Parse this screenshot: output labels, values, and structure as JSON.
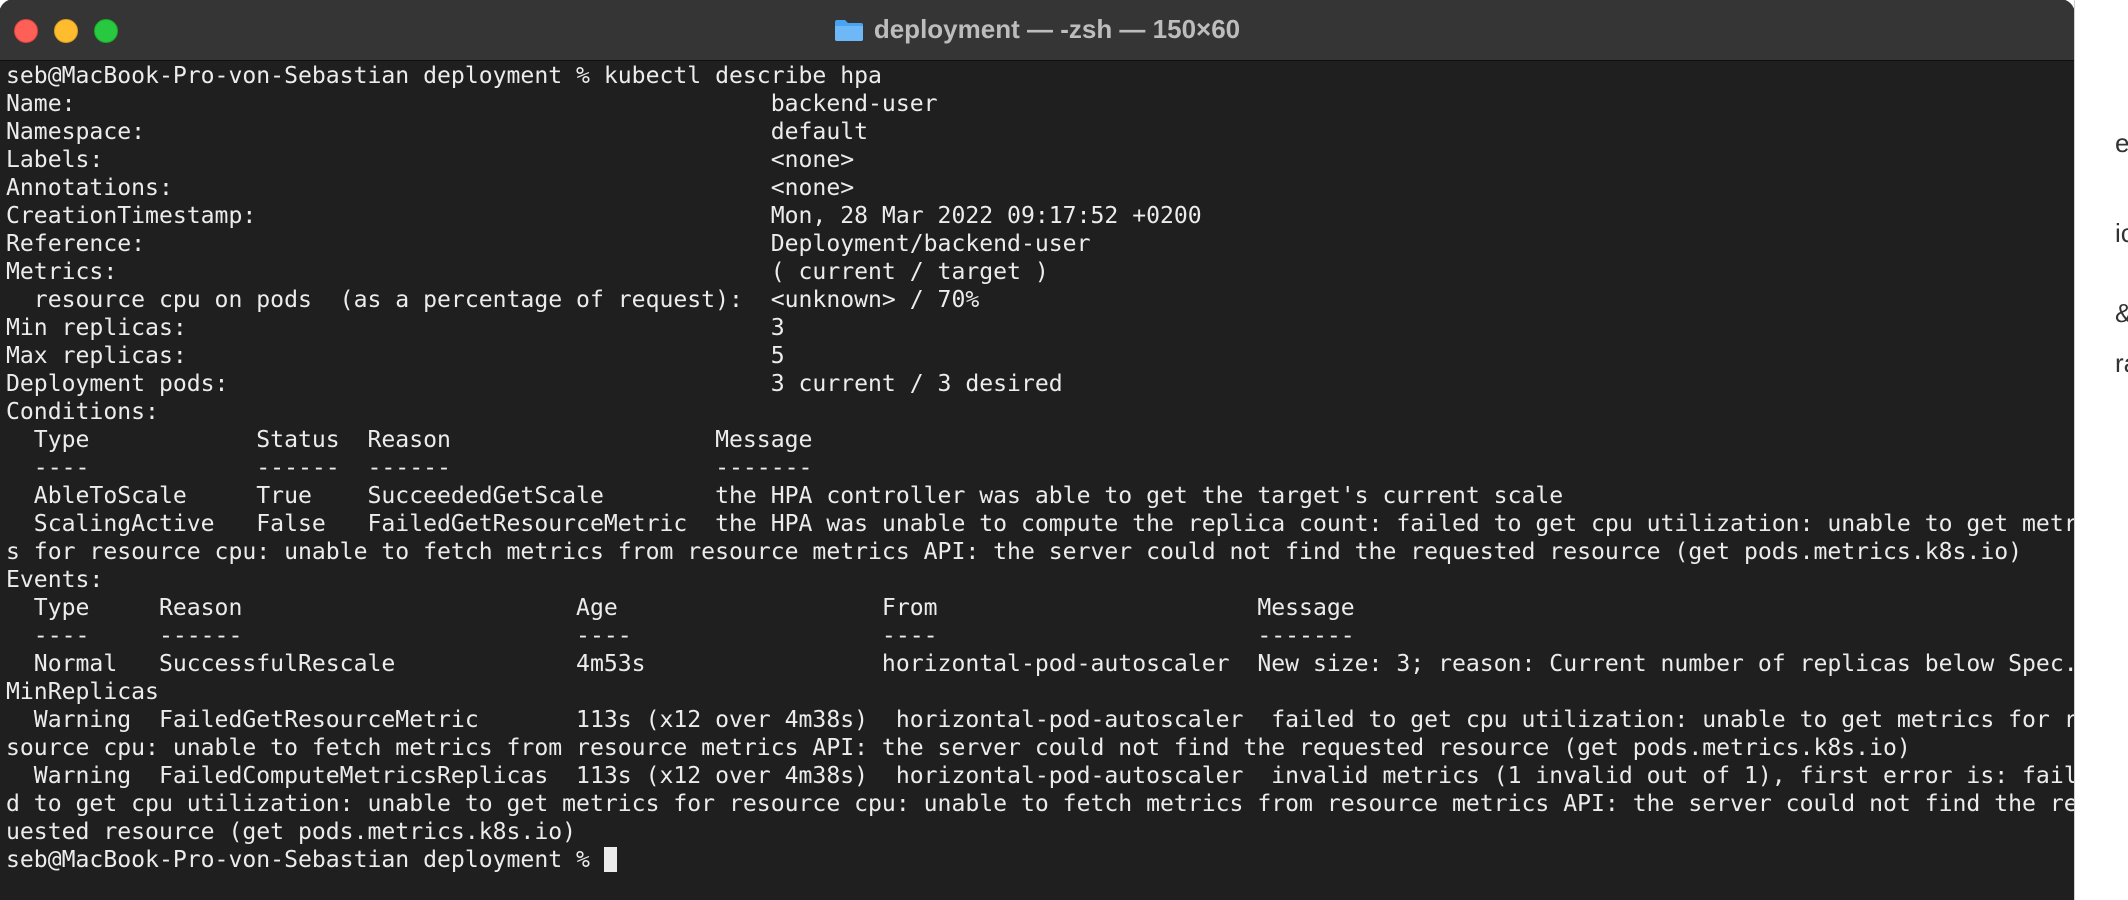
{
  "window": {
    "title": "deployment — -zsh — 150×60",
    "folder_icon": "folder-icon"
  },
  "terminal": {
    "lines": [
      "seb@MacBook-Pro-von-Sebastian deployment % kubectl describe hpa",
      "Name:                                                  backend-user",
      "Namespace:                                             default",
      "Labels:                                                <none>",
      "Annotations:                                           <none>",
      "CreationTimestamp:                                     Mon, 28 Mar 2022 09:17:52 +0200",
      "Reference:                                             Deployment/backend-user",
      "Metrics:                                               ( current / target )",
      "  resource cpu on pods  (as a percentage of request):  <unknown> / 70%",
      "Min replicas:                                          3",
      "Max replicas:                                          5",
      "Deployment pods:                                       3 current / 3 desired",
      "Conditions:",
      "  Type            Status  Reason                   Message",
      "  ----            ------  ------                   -------",
      "  AbleToScale     True    SucceededGetScale        the HPA controller was able to get the target's current scale",
      "  ScalingActive   False   FailedGetResourceMetric  the HPA was unable to compute the replica count: failed to get cpu utilization: unable to get metric",
      "s for resource cpu: unable to fetch metrics from resource metrics API: the server could not find the requested resource (get pods.metrics.k8s.io)",
      "Events:",
      "  Type     Reason                        Age                   From                       Message",
      "  ----     ------                        ----                  ----                       -------",
      "  Normal   SuccessfulRescale             4m53s                 horizontal-pod-autoscaler  New size: 3; reason: Current number of replicas below Spec.",
      "MinReplicas",
      "  Warning  FailedGetResourceMetric       113s (x12 over 4m38s)  horizontal-pod-autoscaler  failed to get cpu utilization: unable to get metrics for re",
      "source cpu: unable to fetch metrics from resource metrics API: the server could not find the requested resource (get pods.metrics.k8s.io)",
      "  Warning  FailedComputeMetricsReplicas  113s (x12 over 4m38s)  horizontal-pod-autoscaler  invalid metrics (1 invalid out of 1), first error is: faile",
      "d to get cpu utilization: unable to get metrics for resource cpu: unable to fetch metrics from resource metrics API: the server could not find the req",
      "uested resource (get pods.metrics.k8s.io)"
    ],
    "prompt": "seb@MacBook-Pro-von-Sebastian deployment % "
  },
  "background_fragments": [
    "e-",
    "ic",
    "&",
    "ra"
  ]
}
